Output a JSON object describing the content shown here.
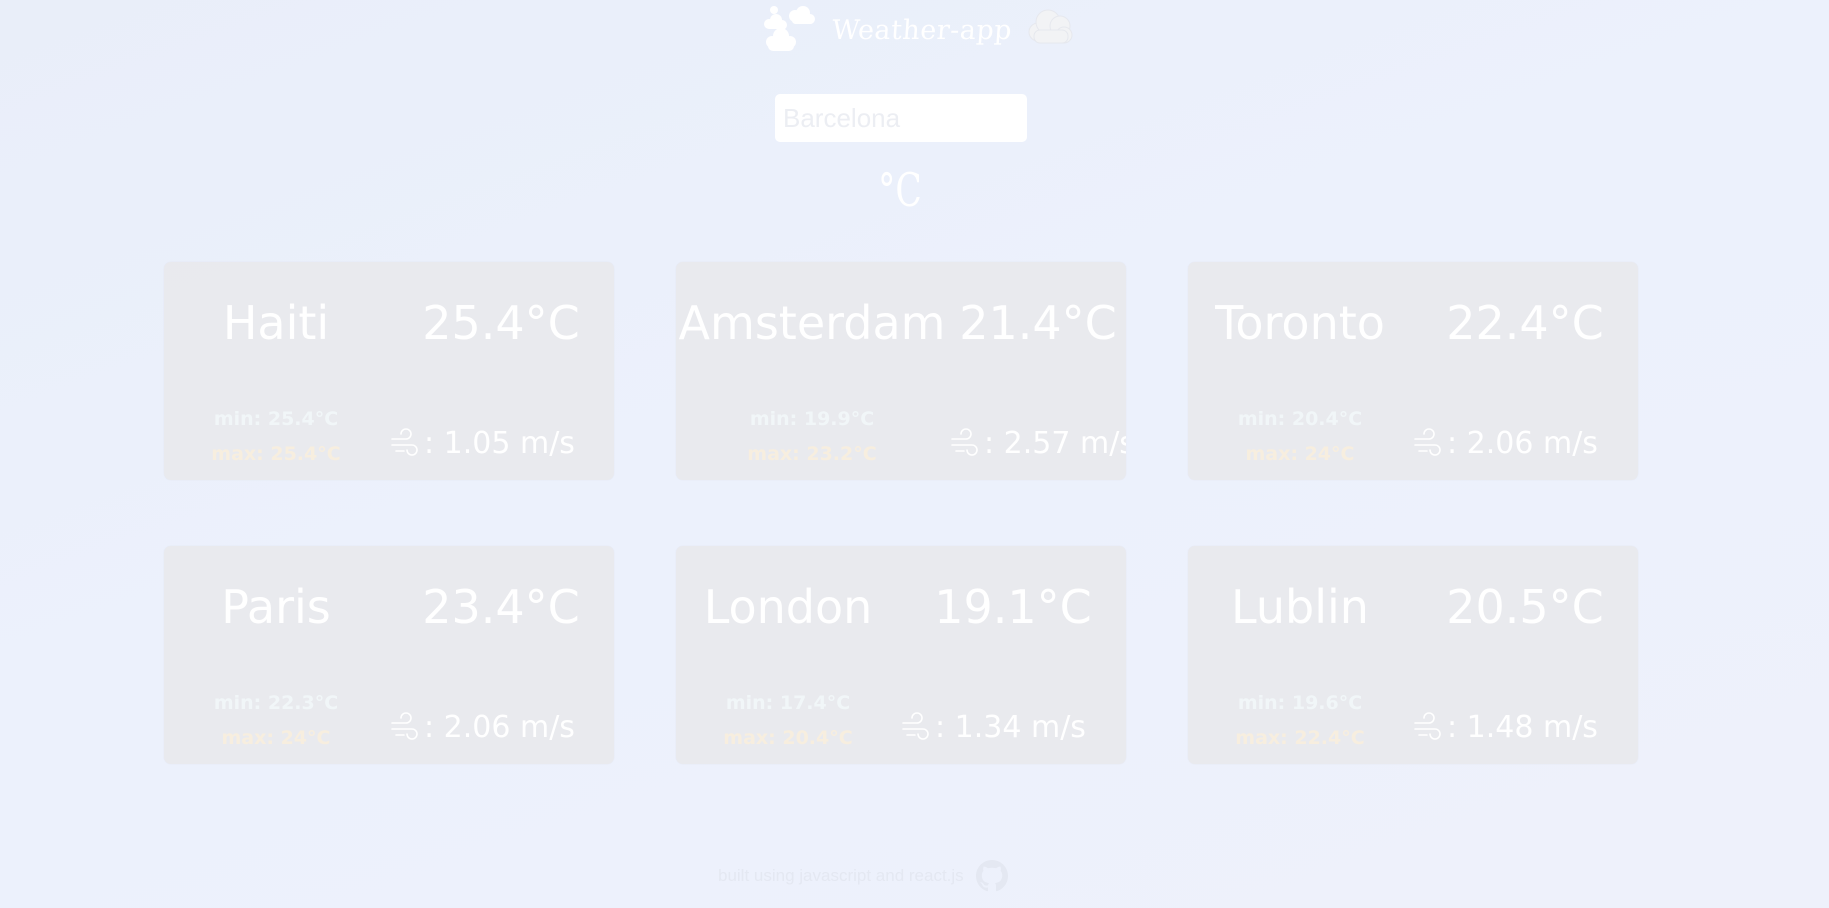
{
  "app": {
    "title": "Weather-app"
  },
  "search": {
    "placeholder": "Barcelona",
    "value": ""
  },
  "unit_toggle": {
    "label": "°C"
  },
  "cards": [
    {
      "city": "Haiti",
      "temp": "25.4°C",
      "min": "min: 25.4°C",
      "max": "max: 25.4°C",
      "wind": ": 1.05 m/s"
    },
    {
      "city": "Amsterdam",
      "temp": "21.4°C",
      "min": "min: 19.9°C",
      "max": "max: 23.2°C",
      "wind": ": 2.57 m/s"
    },
    {
      "city": "Toronto",
      "temp": "22.4°C",
      "min": "min: 20.4°C",
      "max": "max: 24°C",
      "wind": ": 2.06 m/s"
    },
    {
      "city": "Paris",
      "temp": "23.4°C",
      "min": "min: 22.3°C",
      "max": "max: 24°C",
      "wind": ": 2.06 m/s"
    },
    {
      "city": "London",
      "temp": "19.1°C",
      "min": "min: 17.4°C",
      "max": "max: 20.4°C",
      "wind": ": 1.34 m/s"
    },
    {
      "city": "Lublin",
      "temp": "20.5°C",
      "min": "min: 19.6°C",
      "max": "max: 22.4°C",
      "wind": ": 1.48 m/s"
    }
  ],
  "footer": {
    "text": "built using javascript and react.js"
  },
  "colors": {
    "min_text": "#f1f6f8",
    "max_text": "#f7eedf",
    "card_bg": "#e8e8ec"
  },
  "icons": {
    "logo_left": "cloud-sun-icon",
    "logo_right": "cloud-icon",
    "wind": "wind-icon",
    "footer": "github-icon"
  }
}
